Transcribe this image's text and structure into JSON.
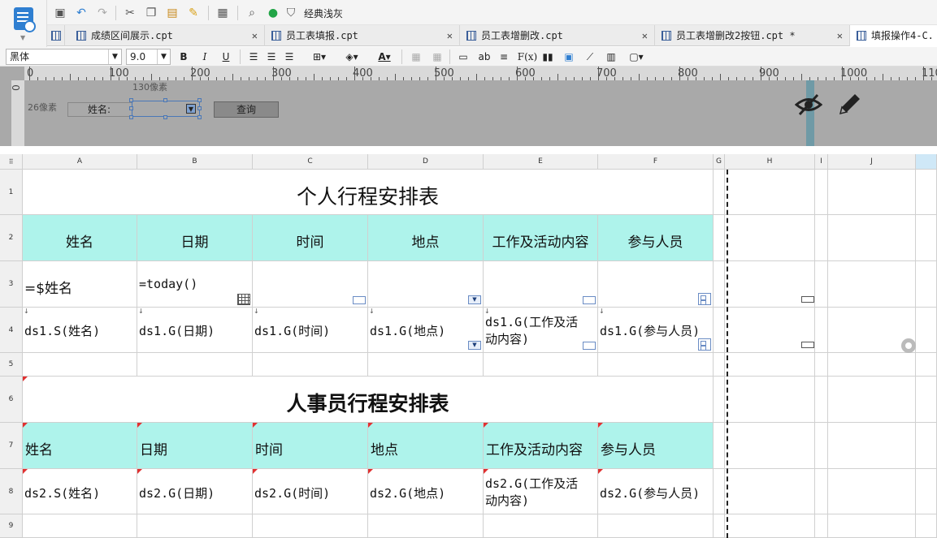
{
  "toolbar": {
    "classic_label": "经典浅灰"
  },
  "tabs": [
    {
      "label": "成绩区间展示.cpt",
      "active": false
    },
    {
      "label": "员工表填报.cpt",
      "active": false
    },
    {
      "label": "员工表增删改.cpt",
      "active": false
    },
    {
      "label": "员工表增删改2按钮.cpt *",
      "active": false
    },
    {
      "label": "填报操作4-C.",
      "active": true
    }
  ],
  "format_bar": {
    "font_name": "黑体",
    "font_size": "9.0",
    "bold": "B",
    "italic": "I",
    "underline": "U",
    "text_ab": "ab",
    "fx": "F(x)"
  },
  "param_panel": {
    "ruler_marks": [
      "0",
      "100",
      "200",
      "300",
      "400",
      "500",
      "600",
      "700",
      "800",
      "900",
      "1000",
      "110"
    ],
    "vertical_ruler_mark": "0",
    "hint_width": "130像素",
    "hint_height": "26像素",
    "name_label": "姓名:",
    "query_button": "查询"
  },
  "sheet": {
    "columns": [
      "A",
      "B",
      "C",
      "D",
      "E",
      "F",
      "G",
      "H",
      "I",
      "J"
    ],
    "rows": [
      "1",
      "2",
      "3",
      "4",
      "5",
      "6",
      "7",
      "8",
      "9"
    ],
    "title1": "个人行程安排表",
    "header1": [
      "姓名",
      "日期",
      "时间",
      "地点",
      "工作及活动内容",
      "参与人员"
    ],
    "row3": [
      "=$姓名",
      "=today()",
      "",
      "",
      "",
      ""
    ],
    "row4": [
      "ds1.S(姓名)",
      "ds1.G(日期)",
      "ds1.G(时间)",
      "ds1.G(地点)",
      "ds1.G(工作及活\n动内容)",
      "ds1.G(参与人员)"
    ],
    "title2": "人事员行程安排表",
    "header2": [
      "姓名",
      "日期",
      "时间",
      "地点",
      "工作及活动内容",
      "参与人员"
    ],
    "row8": [
      "ds2.S(姓名)",
      "ds2.G(日期)",
      "ds2.G(时间)",
      "ds2.G(地点)",
      "ds2.G(工作及活\n动内容)",
      "ds2.G(参与人员)"
    ]
  },
  "colors": {
    "header_fill": "#aef3eb",
    "param_bg": "#a9a9a9",
    "accent_blue": "#2f7fd1"
  }
}
